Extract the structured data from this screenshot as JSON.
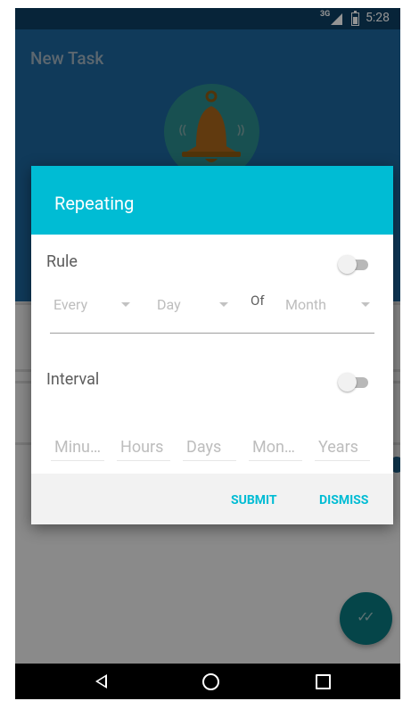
{
  "status_bar": {
    "network": "3G",
    "time": "5:28"
  },
  "header": {
    "title": "New Task"
  },
  "dialog": {
    "title": "Repeating",
    "rule": {
      "label": "Rule",
      "toggle_on": false,
      "every": "Every",
      "day": "Day",
      "of": "Of",
      "month": "Month"
    },
    "interval": {
      "label": "Interval",
      "toggle_on": false,
      "units": [
        "Minu…",
        "Hours",
        "Days",
        "Mon…",
        "Years"
      ]
    },
    "actions": {
      "submit": "SUBMIT",
      "dismiss": "DISMISS"
    }
  },
  "icons": {
    "bell": "bell-icon",
    "fab": "double-check-icon",
    "nav_back": "back-icon",
    "nav_home": "home-icon",
    "nav_recents": "recents-icon"
  },
  "colors": {
    "status_bar": "#0d3f63",
    "app_header": "#1c649c",
    "dialog_header": "#00bcd4",
    "accent": "#00bcd4",
    "fab": "#0a787e"
  }
}
